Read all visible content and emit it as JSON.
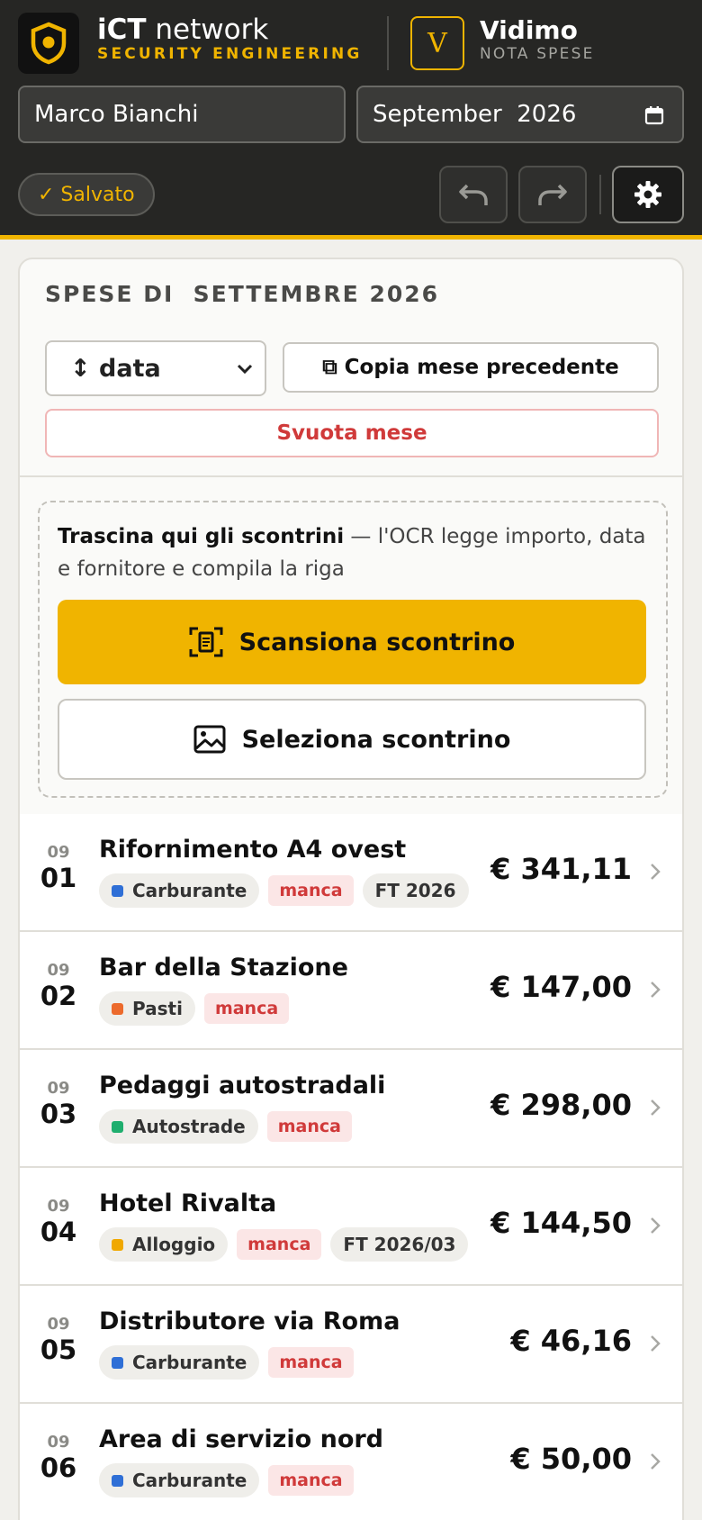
{
  "header": {
    "brand_strong": "iCT",
    "brand_rest": " network",
    "brand_sub": "SECURITY ENGINEERING",
    "app_letter": "V",
    "app_name": "Vidimo",
    "app_sub": "NOTA SPESE",
    "employee_name": "Marco Bianchi",
    "month_value": "September  2026",
    "saved_status": "✓ Salvato",
    "icons": [
      "shield-logo-icon",
      "calendar-icon",
      "undo-icon",
      "redo-icon",
      "gear-icon"
    ]
  },
  "card": {
    "title": "SPESE DI  SETTEMBRE 2026",
    "sort_label": "↕ data",
    "copy_label": "⧉ Copia mese precedente",
    "clear_label": "Svuota mese"
  },
  "dropzone": {
    "text_strong": "Trascina qui gli scontrini",
    "text_rest": " — l'OCR legge importo, data e fornitore e compila la riga",
    "scan_label": "Scansiona scontrino",
    "select_label": "Seleziona scontrino"
  },
  "expenses": [
    {
      "month": "09",
      "day": "01",
      "title": "Rifornimento A4 ovest",
      "category": "Carburante",
      "category_color": "#2f6fd6",
      "missing": "manca",
      "ref": "FT 2026",
      "amount": "€ 341,11"
    },
    {
      "month": "09",
      "day": "02",
      "title": "Bar della Stazione",
      "category": "Pasti",
      "category_color": "#ec6a2c",
      "missing": "manca",
      "ref": "",
      "amount": "€ 147,00"
    },
    {
      "month": "09",
      "day": "03",
      "title": "Pedaggi autostradali",
      "category": "Autostrade",
      "category_color": "#1fae6e",
      "missing": "manca",
      "ref": "",
      "amount": "€ 298,00"
    },
    {
      "month": "09",
      "day": "04",
      "title": "Hotel Rivalta",
      "category": "Alloggio",
      "category_color": "#f0a800",
      "missing": "manca",
      "ref": "FT 2026/03",
      "amount": "€ 144,50"
    },
    {
      "month": "09",
      "day": "05",
      "title": "Distributore via Roma",
      "category": "Carburante",
      "category_color": "#2f6fd6",
      "missing": "manca",
      "ref": "",
      "amount": "€ 46,16"
    },
    {
      "month": "09",
      "day": "06",
      "title": "Area di servizio nord",
      "category": "Carburante",
      "category_color": "#2f6fd6",
      "missing": "manca",
      "ref": "",
      "amount": "€ 50,00"
    }
  ],
  "colors": {
    "accent": "#f0b400",
    "header_bg": "#262624",
    "danger": "#d03a3a"
  }
}
